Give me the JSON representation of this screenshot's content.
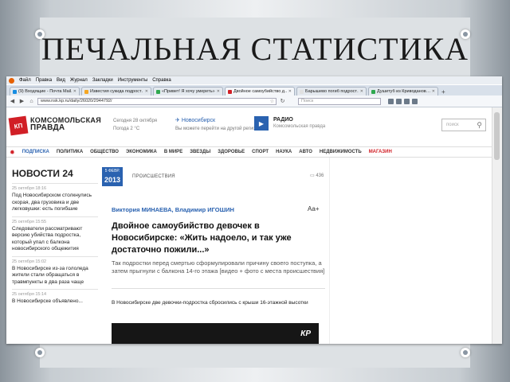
{
  "slide": {
    "title": "ПЕЧАЛЬНАЯ СТАТИСТИКА"
  },
  "browser": {
    "menu": [
      "Файл",
      "Правка",
      "Вид",
      "Журнал",
      "Закладки",
      "Инструменты",
      "Справка"
    ],
    "tabs": [
      {
        "label": "(9) Входящие - Почта Mail.…",
        "fav": "#168de2"
      },
      {
        "label": "Известия сукида подрост…",
        "fav": "#f5a623"
      },
      {
        "label": "«Привет! Я хочу умереть»…",
        "fav": "#2fa84f"
      },
      {
        "label": "Двойное самоубийство д…",
        "fav": "#d11f26"
      },
      {
        "label": "Барышево погиб подрост…",
        "fav": "#e0e0e0"
      },
      {
        "label": "Душитуб из Криводанов…",
        "fav": "#2fa84f"
      }
    ],
    "url": "www.nsk.kp.ru/daily/26020/2944792/",
    "search_placeholder": "Поиск"
  },
  "site": {
    "logo_badge": "КП",
    "logo_line1": "КОМСОМОЛЬСКАЯ",
    "logo_line2": "ПРАВДА",
    "date_line1": "Сегодня 28 октября",
    "date_line2": "Погода 2 °С",
    "region_city": "Новосибирск",
    "region_link": "Вы можете перейти на другой регион",
    "radio_title": "РАДИО",
    "radio_subtitle": "Комсомольская правда",
    "search_placeholder": "поиск",
    "rubrics": [
      {
        "label": "ПОДПИСКА",
        "kind": "sub"
      },
      {
        "label": "ПОЛИТИКА",
        "kind": ""
      },
      {
        "label": "ОБЩЕСТВО",
        "kind": ""
      },
      {
        "label": "ЭКОНОМИКА",
        "kind": ""
      },
      {
        "label": "В МИРЕ",
        "kind": ""
      },
      {
        "label": "ЗВЕЗДЫ",
        "kind": ""
      },
      {
        "label": "ЗДОРОВЬЕ",
        "kind": ""
      },
      {
        "label": "СПОРТ",
        "kind": ""
      },
      {
        "label": "НАУКА",
        "kind": ""
      },
      {
        "label": "АВТО",
        "kind": ""
      },
      {
        "label": "НЕДВИЖИМОСТЬ",
        "kind": ""
      },
      {
        "label": "МАГАЗИН",
        "kind": "shop"
      }
    ],
    "news_heading": "НОВОСТИ 24",
    "news": [
      {
        "time": "25 октября 18:16",
        "text": "Под Новосибирском столкнулись скорая, два грузовика и две легковушки: есть погибшие"
      },
      {
        "time": "25 октября 15:55",
        "text": "Следователи рассматривают версию убийства подростка, который упал с балкона новосибирского общежития"
      },
      {
        "time": "25 октября 15:02",
        "text": "В Новосибирске из-за гололеда жители стали обращаться в травмпункты в два раза чаще"
      },
      {
        "time": "25 октября 15:14",
        "text": "В Новосибирске объявлено..."
      }
    ],
    "article": {
      "date_badge_line1": "5 ФЕВР.",
      "date_badge_line2": "2013",
      "section": "ПРОИСШЕСТВИЯ",
      "comments": "436",
      "authors": "Виктория МИНАЕВА, Владимир ИГОШИН",
      "font_size_control": "Аа+",
      "headline": "Двойное самоубийство девочек в Новосибирске: «Жить надоело, и так уже достаточно пожили...»",
      "lead": "Так подростки перед смертью сформулировали причину своего поступка, а затем прыгнули с балкона 14-го этажа [видео + фото с места происшествия]",
      "body": "В Новосибирске две девочки-подростка сбросились с крыши 16-этажной высотки",
      "video_logo": "КР"
    }
  }
}
